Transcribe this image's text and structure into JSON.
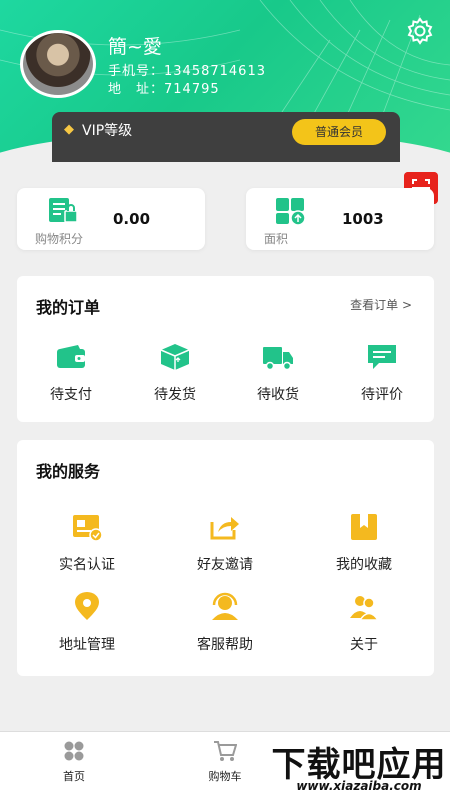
{
  "profile": {
    "name": "簡~愛",
    "phone": "手机号：13458714613",
    "address": "地　址：714795"
  },
  "vip": {
    "label": "VIP等级",
    "level": "普通会员"
  },
  "stats": {
    "points_label": "购物积分",
    "points_value": "0.00",
    "area_label": "面积",
    "area_value": "1003"
  },
  "orders": {
    "title": "我的订单",
    "more": "查看订单 >",
    "items": [
      {
        "label": "待支付",
        "icon": "wallet-icon"
      },
      {
        "label": "待发货",
        "icon": "package-icon"
      },
      {
        "label": "待收货",
        "icon": "truck-icon"
      },
      {
        "label": "待评价",
        "icon": "comment-icon"
      }
    ]
  },
  "services": {
    "title": "我的服务",
    "items": [
      {
        "label": "实名认证",
        "icon": "id-card-icon"
      },
      {
        "label": "好友邀请",
        "icon": "share-icon"
      },
      {
        "label": "我的收藏",
        "icon": "bookmark-icon"
      },
      {
        "label": "地址管理",
        "icon": "location-pin-icon"
      },
      {
        "label": "客服帮助",
        "icon": "headset-icon"
      },
      {
        "label": "关于",
        "icon": "users-icon"
      }
    ]
  },
  "tabbar": {
    "home": "首页",
    "cart": "购物车"
  },
  "watermark": {
    "main": "下载吧应用",
    "url": "www.xiazaiba.com"
  },
  "colors": {
    "brand_green": "#1ed8a0",
    "icon_green": "#22c38a",
    "icon_gold": "#f4b91f",
    "vip_bar": "#3f3f3f",
    "vip_button": "#f3c419",
    "scan_red": "#e7231c"
  }
}
